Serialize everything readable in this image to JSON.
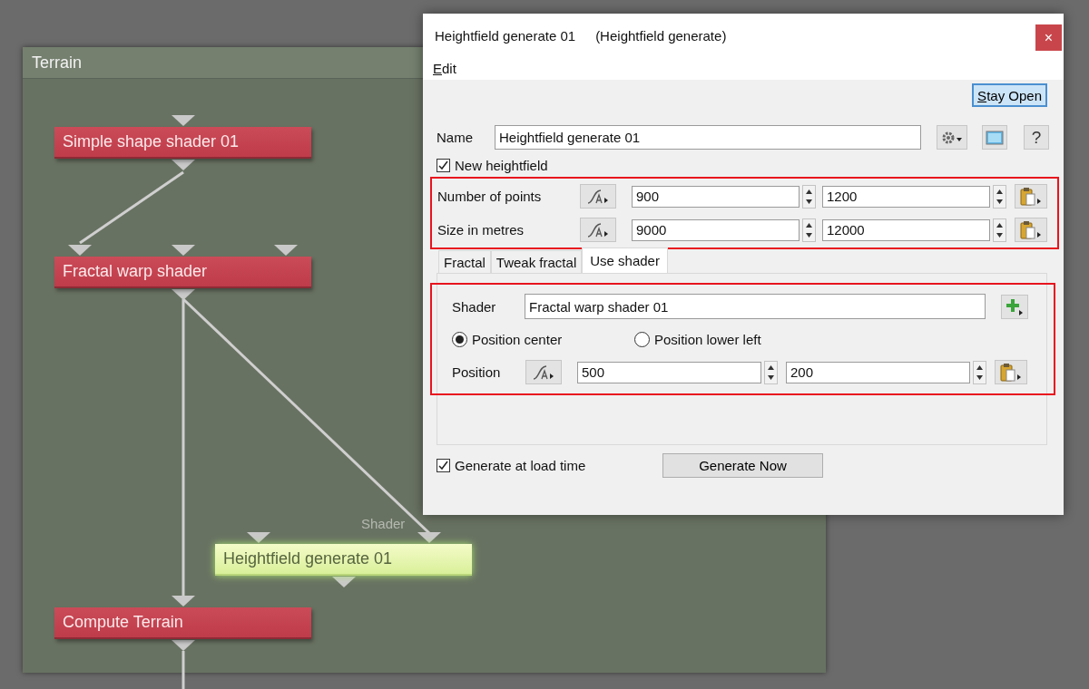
{
  "graph": {
    "title": "Terrain",
    "edge_label": "Shader",
    "nodes": [
      {
        "label": "Simple shape shader 01",
        "selected": false
      },
      {
        "label": "Fractal warp shader",
        "selected": false
      },
      {
        "label": "Heightfield generate 01",
        "selected": true
      },
      {
        "label": "Compute Terrain",
        "selected": false
      }
    ]
  },
  "dialog": {
    "title": "Heightfield generate 01",
    "subtitle": "(Heightfield generate)",
    "close": "×",
    "menu": [
      "Edit"
    ],
    "stay_open": {
      "label": "Stay Open",
      "on": true
    },
    "name": {
      "label": "Name",
      "value": "Heightfield generate 01"
    },
    "help": "?",
    "new_heightfield": {
      "label": "New heightfield",
      "checked": true
    },
    "pair_rows": [
      {
        "label": "Number of points",
        "values": [
          "900",
          "1200"
        ]
      },
      {
        "label": "Size in metres",
        "values": [
          "9000",
          "12000"
        ]
      }
    ],
    "tabs": [
      {
        "label": "Fractal",
        "selected": false
      },
      {
        "label": "Tweak fractal",
        "selected": false
      },
      {
        "label": "Use shader",
        "selected": true
      }
    ],
    "shader": {
      "label": "Shader",
      "value": "Fractal warp shader 01"
    },
    "position_modes": [
      {
        "label": "Position center",
        "selected": true
      },
      {
        "label": "Position lower left",
        "selected": false
      }
    ],
    "position": {
      "label": "Position",
      "values": [
        "500",
        "200"
      ]
    },
    "generate_at_load": {
      "label": "Generate at load time",
      "checked": true
    },
    "generate_button": "Generate Now"
  }
}
